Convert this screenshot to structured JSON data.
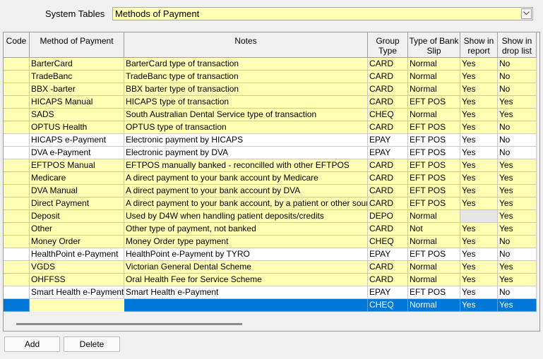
{
  "system_tables": {
    "label": "System Tables",
    "selected": "Methods of Payment"
  },
  "grid": {
    "headers": {
      "code": "Code",
      "method": "Method of Payment",
      "notes": "Notes",
      "group": "Group Type",
      "bank": "Type of Bank Slip",
      "report": "Show in report",
      "drop": "Show in drop list"
    },
    "rows": [
      {
        "code": "",
        "method": "BarterCard",
        "notes": "BarterCard type of transaction",
        "group": "CARD",
        "bank": "Normal",
        "report": "Yes",
        "drop": "No"
      },
      {
        "code": "",
        "method": "TradeBanc",
        "notes": "TradeBanc type of transaction",
        "group": "CARD",
        "bank": "Normal",
        "report": "Yes",
        "drop": "No"
      },
      {
        "code": "",
        "method": "BBX -barter",
        "notes": "BBX barter type of transaction",
        "group": "CARD",
        "bank": "Normal",
        "report": "Yes",
        "drop": "No"
      },
      {
        "code": "",
        "method": "HICAPS Manual",
        "notes": "HICAPS type of transaction",
        "group": "CARD",
        "bank": "EFT POS",
        "report": "Yes",
        "drop": "Yes"
      },
      {
        "code": "",
        "method": "SADS",
        "notes": "South Australian Dental Service type of transaction",
        "group": "CHEQ",
        "bank": "Normal",
        "report": "Yes",
        "drop": "Yes"
      },
      {
        "code": "",
        "method": "OPTUS Health",
        "notes": "OPTUS type of transaction",
        "group": "CARD",
        "bank": "EFT POS",
        "report": "Yes",
        "drop": "No"
      },
      {
        "code": "",
        "method": "HICAPS e-Payment",
        "notes": "Electronic payment by HICAPS",
        "group": "EPAY",
        "bank": "EFT POS",
        "report": "Yes",
        "drop": "No"
      },
      {
        "code": "",
        "method": "DVA e-Payment",
        "notes": "Electronic payment by DVA",
        "group": "EPAY",
        "bank": "EFT POS",
        "report": "Yes",
        "drop": "No"
      },
      {
        "code": "",
        "method": "EFTPOS Manual",
        "notes": "EFTPOS manually banked - reconcilled with other EFTPOS",
        "group": "CARD",
        "bank": "EFT POS",
        "report": "Yes",
        "drop": "Yes"
      },
      {
        "code": "",
        "method": "Medicare",
        "notes": "A direct payment to your bank account by Medicare",
        "group": "CARD",
        "bank": "EFT POS",
        "report": "Yes",
        "drop": "Yes"
      },
      {
        "code": "",
        "method": "DVA Manual",
        "notes": "A direct payment to your bank account by DVA",
        "group": "CARD",
        "bank": "EFT POS",
        "report": "Yes",
        "drop": "Yes"
      },
      {
        "code": "",
        "method": "Direct Payment",
        "notes": "A direct payment to your bank account, by a patient or other source",
        "group": "CARD",
        "bank": "EFT POS",
        "report": "Yes",
        "drop": "Yes"
      },
      {
        "code": "",
        "method": "Deposit",
        "notes": "Used by D4W when handling patient deposits/credits",
        "group": "DEPO",
        "bank": "Normal",
        "report": "",
        "drop": "Yes"
      },
      {
        "code": "",
        "method": "Other",
        "notes": "Other type of payment, not banked",
        "group": "CARD",
        "bank": "Not",
        "report": "Yes",
        "drop": "Yes"
      },
      {
        "code": "",
        "method": "Money Order",
        "notes": "Money Order type payment",
        "group": "CHEQ",
        "bank": "Normal",
        "report": "Yes",
        "drop": "No"
      },
      {
        "code": "",
        "method": "HealthPoint e-Payment",
        "notes": "HealthPoint e-Payment by TYRO",
        "group": "EPAY",
        "bank": "EFT POS",
        "report": "Yes",
        "drop": "No"
      },
      {
        "code": "",
        "method": "VGDS",
        "notes": "Victorian General Dental Scheme",
        "group": "CARD",
        "bank": "Normal",
        "report": "Yes",
        "drop": "Yes"
      },
      {
        "code": "",
        "method": "OHFFSS",
        "notes": "Oral Health Fee for Service Scheme",
        "group": "CARD",
        "bank": "Normal",
        "report": "Yes",
        "drop": "Yes"
      },
      {
        "code": "",
        "method": "Smart Health e-Payment",
        "notes": "Smart Health e-Payment",
        "group": "EPAY",
        "bank": "EFT POS",
        "report": "Yes",
        "drop": "No"
      },
      {
        "code": "",
        "method": "",
        "notes": "",
        "group": "CHEQ",
        "bank": "Normal",
        "report": "Yes",
        "drop": "Yes"
      }
    ]
  },
  "buttons": {
    "add": "Add",
    "delete": "Delete"
  },
  "colors": {
    "editable_row": "#ffffb4",
    "readonly_row": "#ffffff",
    "selected_row": "#0078d7"
  }
}
